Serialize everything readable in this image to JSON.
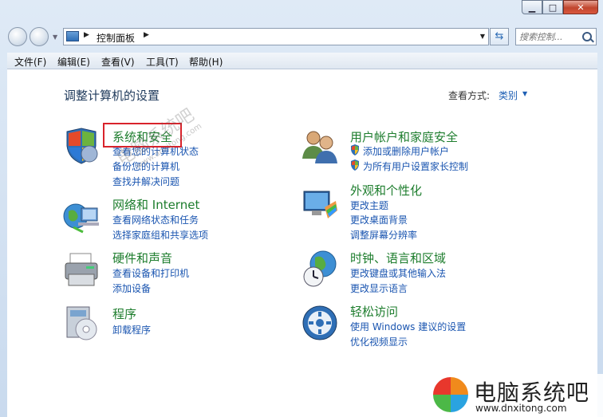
{
  "window": {
    "controls": {
      "minimize": "▁",
      "maximize": "□",
      "close": "✕"
    }
  },
  "navigation": {
    "address_segments": [
      "控制面板"
    ],
    "search_placeholder": "搜索控制...",
    "refresh_icon": "refresh-icon"
  },
  "menu": [
    "文件(F)",
    "编辑(E)",
    "查看(V)",
    "工具(T)",
    "帮助(H)"
  ],
  "content": {
    "heading": "调整计算机的设置",
    "view_by_label": "查看方式:",
    "view_by_value": "类别",
    "categories": [
      {
        "title": "系统和安全",
        "icon": "security-shield-icon",
        "links": [
          "查看您的计算机状态",
          "备份您的计算机",
          "查找并解决问题"
        ]
      },
      {
        "title": "网络和 Internet",
        "icon": "network-globe-icon",
        "links": [
          "查看网络状态和任务",
          "选择家庭组和共享选项"
        ]
      },
      {
        "title": "硬件和声音",
        "icon": "printer-icon",
        "links": [
          "查看设备和打印机",
          "添加设备"
        ]
      },
      {
        "title": "程序",
        "icon": "programs-disc-icon",
        "links": [
          "卸载程序"
        ]
      },
      {
        "title": "用户帐户和家庭安全",
        "icon": "users-icon",
        "links": [
          "添加或删除用户帐户",
          "为所有用户设置家长控制"
        ]
      },
      {
        "title": "外观和个性化",
        "icon": "monitor-palette-icon",
        "links": [
          "更改主题",
          "更改桌面背景",
          "调整屏幕分辨率"
        ]
      },
      {
        "title": "时钟、语言和区域",
        "icon": "clock-globe-icon",
        "links": [
          "更改键盘或其他输入法",
          "更改显示语言"
        ]
      },
      {
        "title": "轻松访问",
        "icon": "ease-of-access-icon",
        "links": [
          "使用 Windows 建议的设置",
          "优化视频显示"
        ]
      }
    ]
  },
  "watermark": {
    "title": "电脑系统吧",
    "url": "www.dnxitong.com",
    "faint_title": "电脑系统吧",
    "faint_url": "www.dnxitong.com"
  },
  "colors": {
    "category_title": "#1d7d2d",
    "link": "#1a55b0",
    "highlight_border": "#d9232b"
  }
}
